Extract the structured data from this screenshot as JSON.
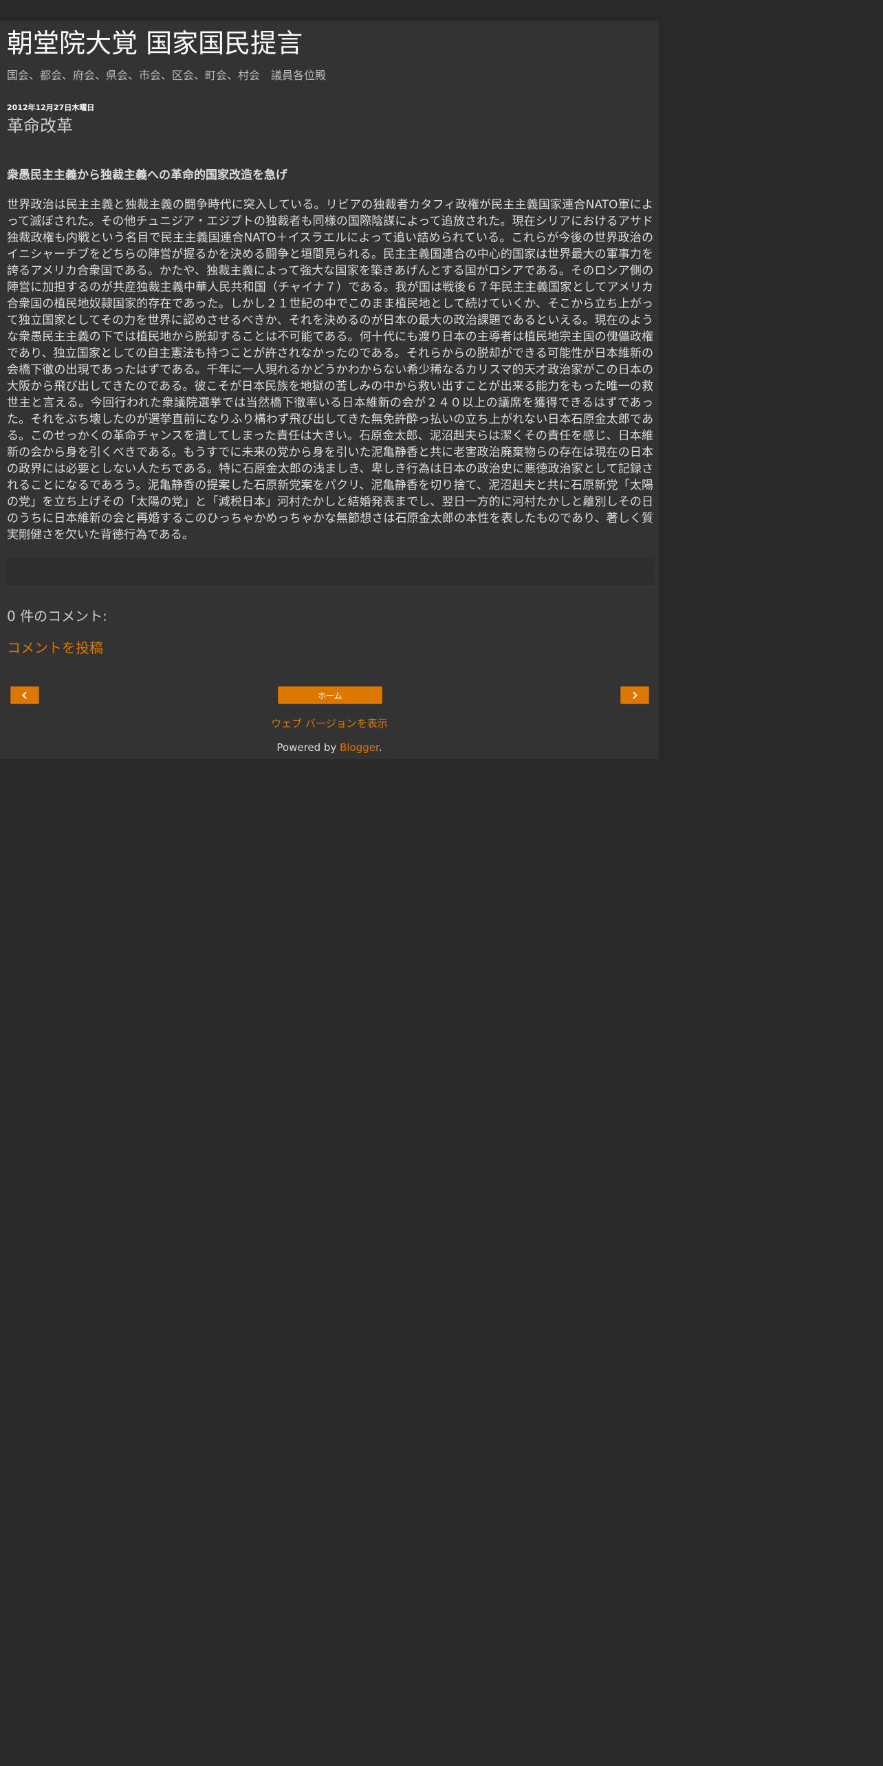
{
  "header": {
    "title": "朝堂院大覚 国家国民提言",
    "description": "国会、都会、府会、県会、市会、区会、町会、村会　議員各位殿"
  },
  "post": {
    "date": "2012年12月27日木曜日",
    "title": "革命改革",
    "heading": "衆愚民主主義から独裁主義への革命的国家改造を急げ",
    "body": "世界政治は民主主義と独裁主義の闘争時代に突入している。リビアの独裁者カタフィ政権が民主主義国家連合NATO軍によって滅ぼされた。その他チュニジア・エジプトの独裁者も同様の国際陰謀によって追放された。現在シリアにおけるアサド独裁政権も内戦という名目で民主主義国連合NATO＋イスラエルによって追い詰められている。これらが今後の世界政治のイニシャーチブをどちらの陣営が握るかを決める闘争と垣間見られる。民主主義国連合の中心的国家は世界最大の軍事力を誇るアメリカ合衆国である。かたや、独裁主義によって強大な国家を築きあげんとする国がロシアである。そのロシア側の陣営に加担するのが共産独裁主義中華人民共和国（チャイナ７）である。我が国は戦後６７年民主主義国家としてアメリカ合衆国の植民地奴隷国家的存在であった。しかし２１世紀の中でこのまま植民地として続けていくか、そこから立ち上がって独立国家としてその力を世界に認めさせるべきか、それを決めるのが日本の最大の政治課題であるといえる。現在のような衆愚民主主義の下では植民地から脱却することは不可能である。何十代にも渡り日本の主導者は植民地宗主国の傀儡政権であり、独立国家としての自主憲法も持つことが許されなかったのである。それらからの脱却ができる可能性が日本維新の会橋下徹の出現であったはずである。千年に一人現れるかどうかわからない希少稀なるカリスマ的天才政治家がこの日本の大阪から飛び出してきたのである。彼こそが日本民族を地獄の苦しみの中から救い出すことが出来る能力をもった唯一の救世主と言える。今回行われた衆議院選挙では当然橋下徹率いる日本維新の会が２４０以上の議席を獲得できるはずであった。それをぶち壊したのが選挙直前になりふり構わず飛び出してきた無免許酔っ払いの立ち上がれない日本石原金太郎である。このせっかくの革命チャンスを潰してしまった責任は大きい。石原金太郎、泥沼赳夫らは潔くその責任を感じ、日本維新の会から身を引くべきである。もうすでに未来の党から身を引いた泥亀静香と共に老害政治廃棄物らの存在は現在の日本の政界には必要としない人たちである。特に石原金太郎の浅ましき、卑しき行為は日本の政治史に悪徳政治家として記録されることになるであろう。泥亀静香の提案した石原新党案をパクリ、泥亀静香を切り捨て、泥沼赳夫と共に石原新党「太陽の党」を立ち上げその「太陽の党」と「減税日本」河村たかしと結婚発表までし、翌日一方的に河村たかしと離別しその日のうちに日本維新の会と再婚するこのひっちゃかめっちゃかな無節想さは石原金太郎の本性を表したものであり、著しく質実剛健さを欠いた背徳行為である。"
  },
  "comments": {
    "count_label": "0 件のコメント:",
    "post_comment_link": "コメントを投稿"
  },
  "navigation": {
    "prev_icon": "chevron-left-icon",
    "home_label": "ホーム",
    "next_icon": "chevron-right-icon"
  },
  "footer": {
    "web_version_link": "ウェブ バージョンを表示",
    "powered_by": "Powered by ",
    "powered_by_link": "Blogger",
    "powered_by_suffix": "."
  },
  "colors": {
    "background": "#292929",
    "content_background": "#333333",
    "accent": "#dd7700",
    "text": "#dddddd",
    "title": "#ffffff"
  }
}
